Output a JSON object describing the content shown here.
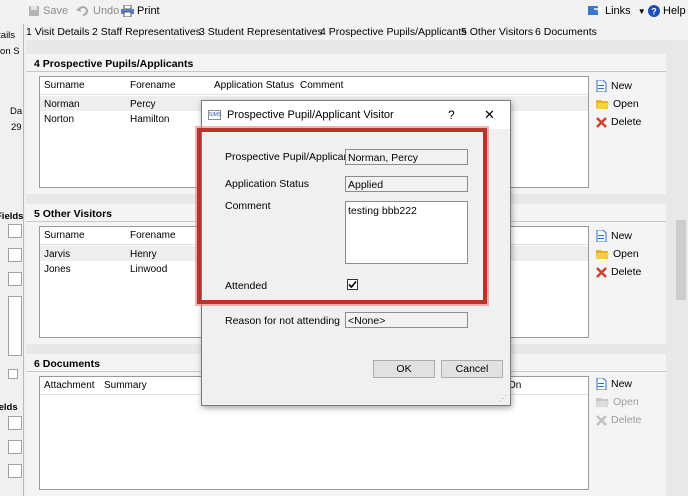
{
  "toolbar": {
    "save": "Save",
    "undo": "Undo",
    "print": "Print",
    "links": "Links",
    "help": "Help"
  },
  "tabs": [
    "1 Visit Details",
    "2 Staff Representatives",
    "3 Student Representatives",
    "4 Prospective Pupils/Applicants",
    "5 Other Visitors",
    "6 Documents"
  ],
  "left_panel": {
    "details": "Details",
    "ation": "ation S",
    "da": "Da",
    "day": "29",
    "fields1": "Fields",
    "fields2": "ields"
  },
  "sections": {
    "prospective": {
      "title": "4 Prospective Pupils/Applicants",
      "columns": [
        "Surname",
        "Forename",
        "Application Status",
        "Comment"
      ],
      "rows": [
        [
          "Norman",
          "Percy"
        ],
        [
          "Norton",
          "Hamilton"
        ]
      ],
      "buttons": {
        "new": "New",
        "open": "Open",
        "delete": "Delete"
      }
    },
    "other_visitors": {
      "title": "5 Other Visitors",
      "columns": [
        "Surname",
        "Forename"
      ],
      "rows": [
        [
          "Jarvis",
          "Henry"
        ],
        [
          "Jones",
          "Linwood"
        ]
      ],
      "buttons": {
        "new": "New",
        "open": "Open",
        "delete": "Delete"
      }
    },
    "documents": {
      "title": "6 Documents",
      "columns": [
        "Attachment",
        "Summary",
        "On"
      ],
      "buttons": {
        "new": "New",
        "open": "Open",
        "delete": "Delete"
      }
    }
  },
  "dialog": {
    "title": "Prospective Pupil/Applicant Visitor",
    "app_icon": "SIMS",
    "help": "?",
    "close": "✕",
    "fields": {
      "pupil_label": "Prospective Pupil/Applicant",
      "pupil_value": "Norman, Percy",
      "status_label": "Application Status",
      "status_value": "Applied",
      "comment_label": "Comment",
      "comment_value": "testing bbb222",
      "attended_label": "Attended",
      "attended_checked": true,
      "reason_label": "Reason for not attending",
      "reason_value": "<None>"
    },
    "ok": "OK",
    "cancel": "Cancel"
  },
  "colors": {
    "highlight": "#b8342a",
    "help_icon": "#1f4fb5",
    "delete_x": "#d2402e",
    "new_doc": "#2f6fbf",
    "open_folder": "#e6b526"
  },
  "icons": [
    "save-icon",
    "undo-icon",
    "print-icon",
    "links-icon",
    "help-icon",
    "new-icon",
    "open-folder-icon",
    "delete-icon",
    "checkbox-icon"
  ]
}
